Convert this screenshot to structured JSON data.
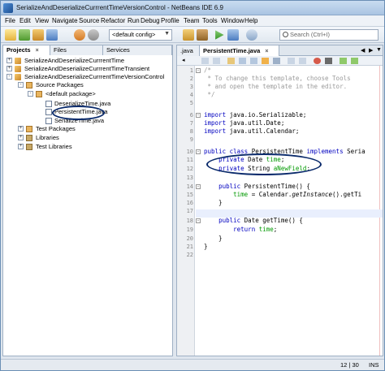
{
  "window": {
    "title": "SerializeAndDeserializeCurrrentTimeVersionControl - NetBeans IDE 6.9"
  },
  "menu": [
    "File",
    "Edit",
    "View",
    "Navigate",
    "Source",
    "Refactor",
    "Run",
    "Debug",
    "Profile",
    "Team",
    "Tools",
    "Window",
    "Help"
  ],
  "toolbar": {
    "config_value": "<default config>",
    "search_placeholder": "Search (Ctrl+I)"
  },
  "left_panel": {
    "tabs": [
      "Projects",
      "Files",
      "Services"
    ],
    "tree": [
      {
        "label": "SerializeAndDeserializeCurrrentTime",
        "level": 0,
        "icon": "project-icon",
        "toggle": "+"
      },
      {
        "label": "SerializeAndDeserializeCurrrentTimeTransient",
        "level": 0,
        "icon": "project-icon",
        "toggle": "+"
      },
      {
        "label": "SerializeAndDeserializeCurrrentTimeVersionControl",
        "level": 0,
        "icon": "project-icon",
        "toggle": "-"
      },
      {
        "label": "Source Packages",
        "level": 1,
        "icon": "package-folder-icon",
        "toggle": "-"
      },
      {
        "label": "<default package>",
        "level": 2,
        "icon": "package-icon",
        "toggle": "-"
      },
      {
        "label": "DeserializeTime.java",
        "level": 3,
        "icon": "java-file-icon",
        "toggle": ""
      },
      {
        "label": "PersistentTime.java",
        "level": 3,
        "icon": "java-file-icon",
        "toggle": ""
      },
      {
        "label": "SerializeTime.java",
        "level": 3,
        "icon": "java-file-icon",
        "toggle": ""
      },
      {
        "label": "Test Packages",
        "level": 1,
        "icon": "package-folder-icon",
        "toggle": "+"
      },
      {
        "label": "Libraries",
        "level": 1,
        "icon": "library-icon",
        "toggle": "+"
      },
      {
        "label": "Test Libraries",
        "level": 1,
        "icon": "library-icon",
        "toggle": "+"
      }
    ]
  },
  "editor": {
    "tabs": [
      ".java",
      "PersistentTime.java"
    ],
    "lines": [
      {
        "n": "1",
        "text": "/*"
      },
      {
        "n": "2",
        "text": " * To change this template, choose Tools"
      },
      {
        "n": "3",
        "text": " * and open the template in the editor."
      },
      {
        "n": "4",
        "text": " */"
      },
      {
        "n": "5",
        "text": ""
      },
      {
        "n": "6",
        "text": "import java.io.Serializable;"
      },
      {
        "n": "7",
        "text": "import java.util.Date;"
      },
      {
        "n": "8",
        "text": "import java.util.Calendar;"
      },
      {
        "n": "9",
        "text": ""
      },
      {
        "n": "10",
        "text": "public class PersistentTime implements Seria"
      },
      {
        "n": "11",
        "text": "    private Date time;"
      },
      {
        "n": "12",
        "text": "    private String aNewField;"
      },
      {
        "n": "13",
        "text": ""
      },
      {
        "n": "14",
        "text": "    public PersistentTime() {"
      },
      {
        "n": "15",
        "text": "        time = Calendar.getInstance().getTi"
      },
      {
        "n": "16",
        "text": "    }"
      },
      {
        "n": "17",
        "text": ""
      },
      {
        "n": "18",
        "text": "    public Date getTime() {"
      },
      {
        "n": "19",
        "text": "        return time;"
      },
      {
        "n": "20",
        "text": "    }"
      },
      {
        "n": "21",
        "text": "}"
      },
      {
        "n": "22",
        "text": ""
      }
    ]
  },
  "status": {
    "position": "12 | 30",
    "mode": "INS"
  },
  "colors": {
    "keyword": "#0000c0",
    "comment": "#9a9a9a",
    "field": "#009900",
    "annotation_ellipse": "#0a2a6b"
  }
}
